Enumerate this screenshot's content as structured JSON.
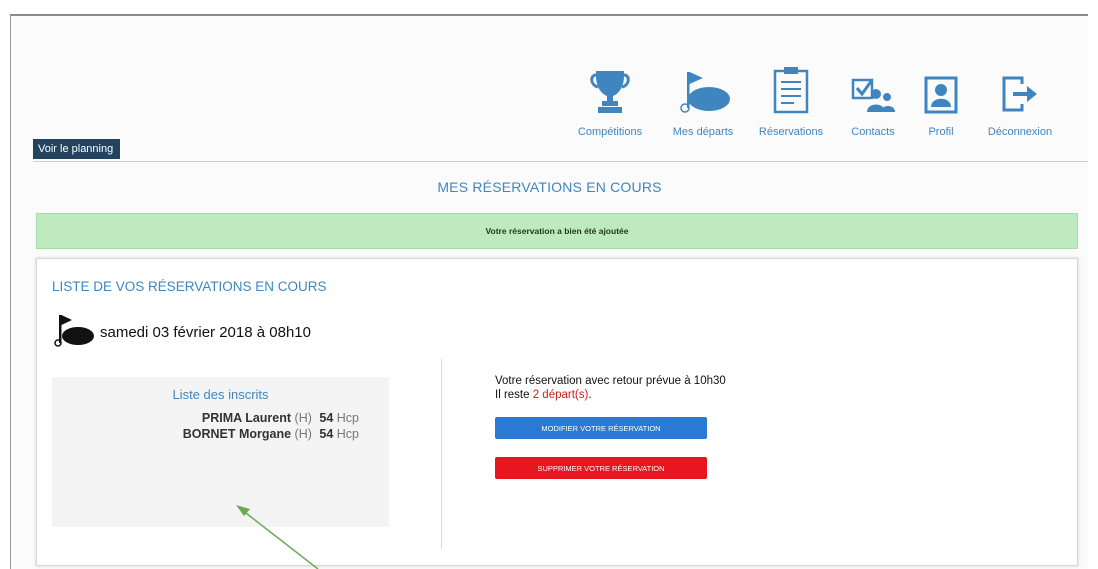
{
  "nav": {
    "items": [
      {
        "key": "competitions",
        "label": "Compétitions",
        "icon": "trophy-icon"
      },
      {
        "key": "mes-departs",
        "label": "Mes départs",
        "icon": "golf-flag-icon"
      },
      {
        "key": "reservations",
        "label": "Réservations",
        "icon": "clipboard-icon"
      },
      {
        "key": "contacts",
        "label": "Contacts",
        "icon": "contacts-icon"
      },
      {
        "key": "profil",
        "label": "Profil",
        "icon": "profile-icon"
      },
      {
        "key": "deconnexion",
        "label": "Déconnexion",
        "icon": "logout-icon"
      }
    ],
    "icon_color": "#3f86c0"
  },
  "voir_planning": "Voir le planning",
  "page_title": "MES RÉSERVATIONS EN COURS",
  "alert": {
    "text": "Votre réservation a bien été ajoutée",
    "color": "#bfe9bf"
  },
  "card": {
    "title": "LISTE DE VOS RÉSERVATIONS EN COURS",
    "date": "samedi 03 février 2018 à 08h10",
    "inscrits": {
      "title": "Liste des inscrits",
      "players": [
        {
          "name": "PRIMA Laurent",
          "gender": "(H)",
          "hcp": "54",
          "hcp_label": "Hcp"
        },
        {
          "name": "BORNET Morgane",
          "gender": "(H)",
          "hcp": "54",
          "hcp_label": "Hcp"
        }
      ]
    },
    "info": {
      "line1": "Votre réservation avec retour prévue à 10h30",
      "reste_prefix": "Il reste",
      "reste_count": "2 départ(s)",
      "reste_suffix": "."
    },
    "modify_button": "MODIFIER VOTRE RÉSERVATION",
    "delete_button": "SUPPRIMER VOTRE RÉSERVATION"
  },
  "colors": {
    "accent": "#3f86c0",
    "dark_button": "#24435e",
    "primary_button": "#2a7ad5",
    "danger_button": "#e8161f",
    "annotation_arrow": "#6aab4f"
  }
}
